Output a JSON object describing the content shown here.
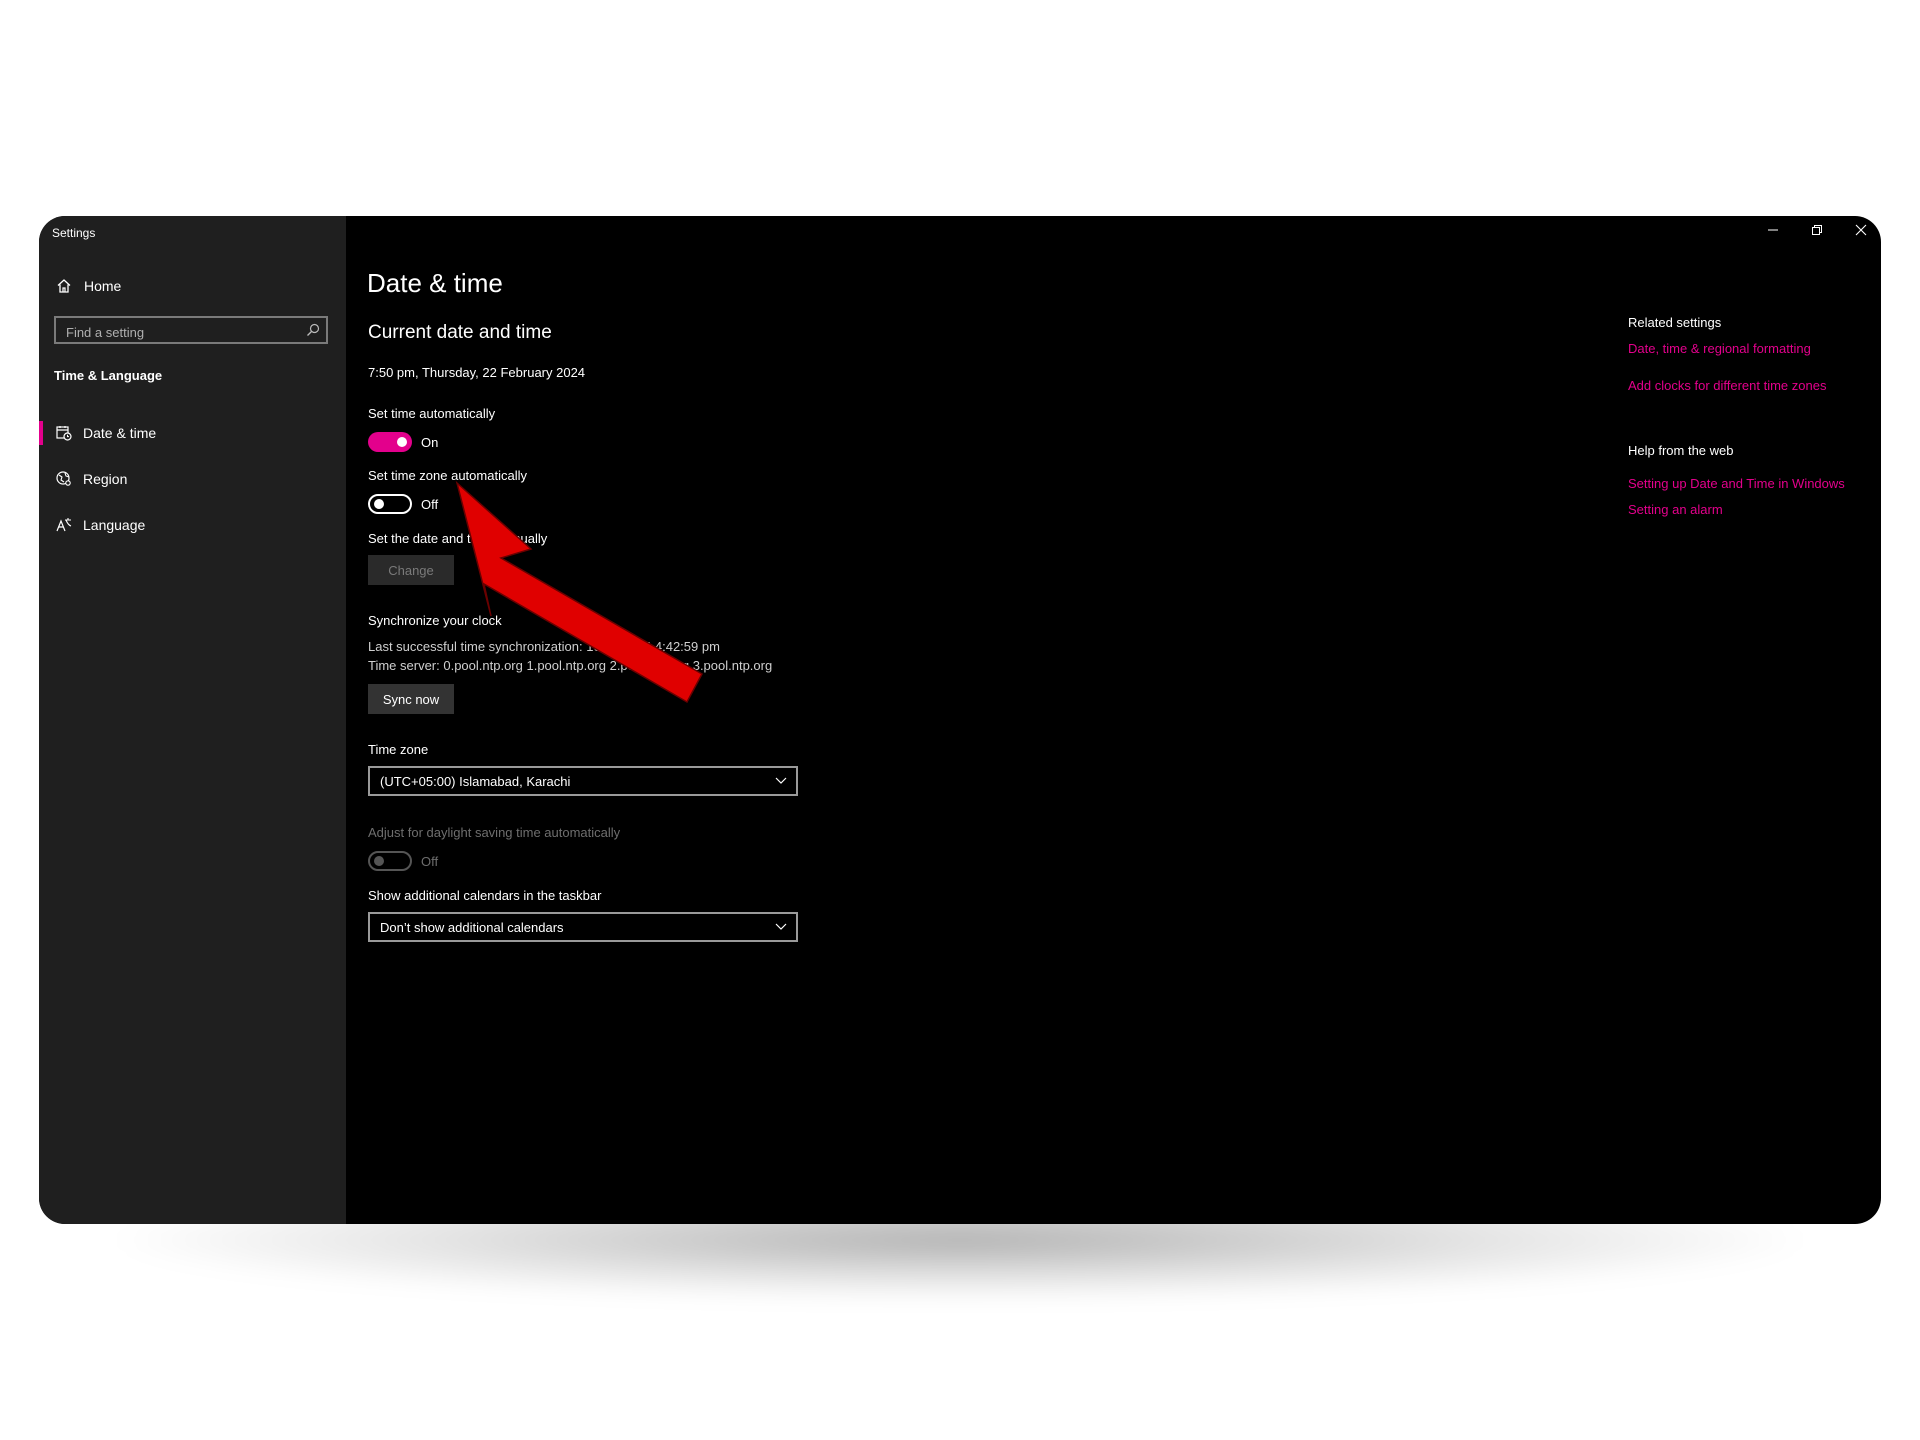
{
  "window": {
    "title": "Settings",
    "controls": {
      "minimize_icon": "minimize-icon",
      "restore_icon": "restore-icon",
      "close_icon": "close-icon"
    }
  },
  "sidebar": {
    "home_label": "Home",
    "search_placeholder": "Find a setting",
    "section_title": "Time & Language",
    "items": [
      {
        "label": "Date & time",
        "icon": "calendar-clock-icon",
        "selected": true
      },
      {
        "label": "Region",
        "icon": "globe-icon",
        "selected": false
      },
      {
        "label": "Language",
        "icon": "language-icon",
        "selected": false
      }
    ]
  },
  "main": {
    "page_title": "Date & time",
    "section_title": "Current date and time",
    "current_datetime": "7:50 pm, Thursday, 22 February 2024",
    "set_time_auto": {
      "label": "Set time automatically",
      "state": "On"
    },
    "set_timezone_auto": {
      "label": "Set time zone automatically",
      "state": "Off"
    },
    "set_manually": {
      "label": "Set the date and time manually",
      "button": "Change"
    },
    "sync": {
      "title": "Synchronize your clock",
      "last_sync": "Last successful time synchronization: 16/02/2024 4:42:59 pm",
      "time_server": "Time server: 0.pool.ntp.org 1.pool.ntp.org 2.pool.ntp.org 3.pool.ntp.org",
      "button": "Sync now"
    },
    "time_zone": {
      "label": "Time zone",
      "value": "(UTC+05:00) Islamabad, Karachi"
    },
    "daylight": {
      "label": "Adjust for daylight saving time automatically",
      "state": "Off"
    },
    "calendars": {
      "label": "Show additional calendars in the taskbar",
      "value": "Don’t show additional calendars"
    }
  },
  "related": {
    "title": "Related settings",
    "links": [
      "Date, time & regional formatting",
      "Add clocks for different time zones"
    ],
    "help_title": "Help from the web",
    "help_links": [
      "Setting up Date and Time in Windows",
      "Setting an alarm"
    ]
  },
  "colors": {
    "accent": "#e3008c",
    "sidebar_bg": "#1f1f1f",
    "content_bg": "#000000",
    "annotation_arrow": "#e00000"
  }
}
